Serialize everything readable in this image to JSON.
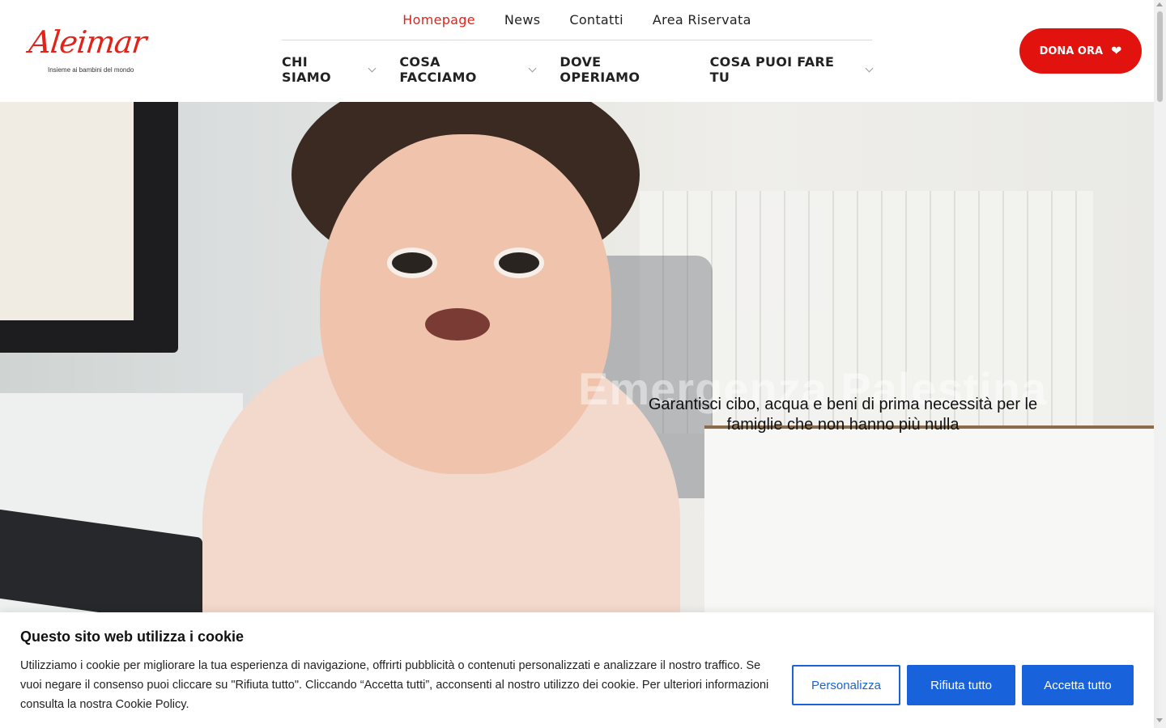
{
  "brand": {
    "name": "Aleimar",
    "tagline": "Insieme ai bambini del mondo",
    "accent": "#e2231a"
  },
  "topnav": [
    {
      "label": "Homepage",
      "active": true
    },
    {
      "label": "News",
      "active": false
    },
    {
      "label": "Contatti",
      "active": false
    },
    {
      "label": "Area Riservata",
      "active": false
    }
  ],
  "mainnav": [
    {
      "label": "CHI SIAMO",
      "dropdown": true
    },
    {
      "label": "COSA FACCIAMO",
      "dropdown": true
    },
    {
      "label": "DOVE OPERIAMO",
      "dropdown": false
    },
    {
      "label": "COSA PUOI FARE TU",
      "dropdown": true
    }
  ],
  "donate": {
    "label": "DONA ORA",
    "icon": "heart-icon"
  },
  "hero": {
    "title": "Emergenza Palestina",
    "subtitle_line1": "Garantisci cibo, acqua e beni di prima necessità per le",
    "subtitle_line2": "famiglie che non hanno più nulla"
  },
  "cookie": {
    "title": "Questo sito web utilizza i cookie",
    "text": "Utilizziamo i cookie per migliorare la tua esperienza di navigazione, offrirti pubblicità o contenuti personalizzati e analizzare il nostro traffico. Se vuoi negare il consenso puoi cliccare su \"Rifiuta tutto\". Cliccando “Accetta tutti”, acconsenti al nostro utilizzo dei cookie. Per ulteriori informazioni consulta la nostra Cookie Policy.",
    "customize": "Personalizza",
    "reject": "Rifiuta tutto",
    "accept": "Accetta tutto",
    "button_color": "#1863dc"
  }
}
